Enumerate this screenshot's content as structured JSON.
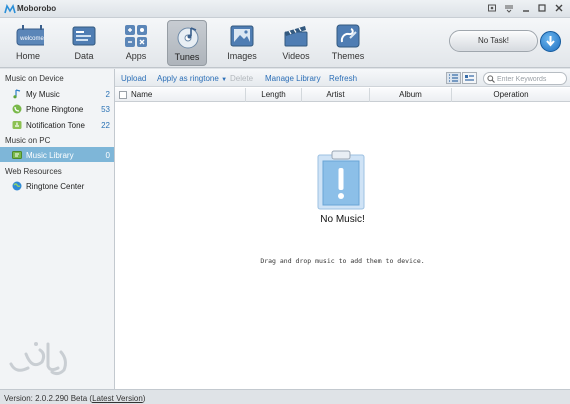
{
  "app": {
    "title": "Moborobo"
  },
  "nav": [
    {
      "label": "Home",
      "icon": "home-icon"
    },
    {
      "label": "Data",
      "icon": "data-icon"
    },
    {
      "label": "Apps",
      "icon": "apps-icon"
    },
    {
      "label": "Tunes",
      "icon": "tunes-icon",
      "active": true
    },
    {
      "label": "Images",
      "icon": "images-icon"
    },
    {
      "label": "Videos",
      "icon": "videos-icon"
    },
    {
      "label": "Themes",
      "icon": "themes-icon"
    }
  ],
  "home_badge": "welcome",
  "task": {
    "label": "No Task!"
  },
  "sidebar": {
    "sections": [
      {
        "title": "Music on Device"
      },
      {
        "title": "Music on PC"
      },
      {
        "title": "Web Resources"
      }
    ],
    "items": [
      {
        "label": "My Music",
        "count": "2"
      },
      {
        "label": "Phone Ringtone",
        "count": "53"
      },
      {
        "label": "Notification Tone",
        "count": "22"
      },
      {
        "label": "Music Library",
        "count": "0",
        "selected": true
      },
      {
        "label": "Ringtone Center",
        "count": ""
      }
    ]
  },
  "actions": {
    "upload": "Upload",
    "apply_ringtone": "Apply as ringtone",
    "delete": "Delete",
    "manage_library": "Manage Library",
    "refresh": "Refresh"
  },
  "search": {
    "placeholder": "Enter Keywords"
  },
  "table": {
    "columns": [
      "Name",
      "Length",
      "Artist",
      "Album",
      "Operation"
    ]
  },
  "empty": {
    "title": "No Music!",
    "hint": "Drag and drop music to add them to device."
  },
  "status": {
    "version": "Version: 2.0.2.290 Beta",
    "link": "Latest Version"
  },
  "colors": {
    "selection": "#7eb6d8",
    "link": "#2c6fb7",
    "count": "#2a72b5"
  }
}
